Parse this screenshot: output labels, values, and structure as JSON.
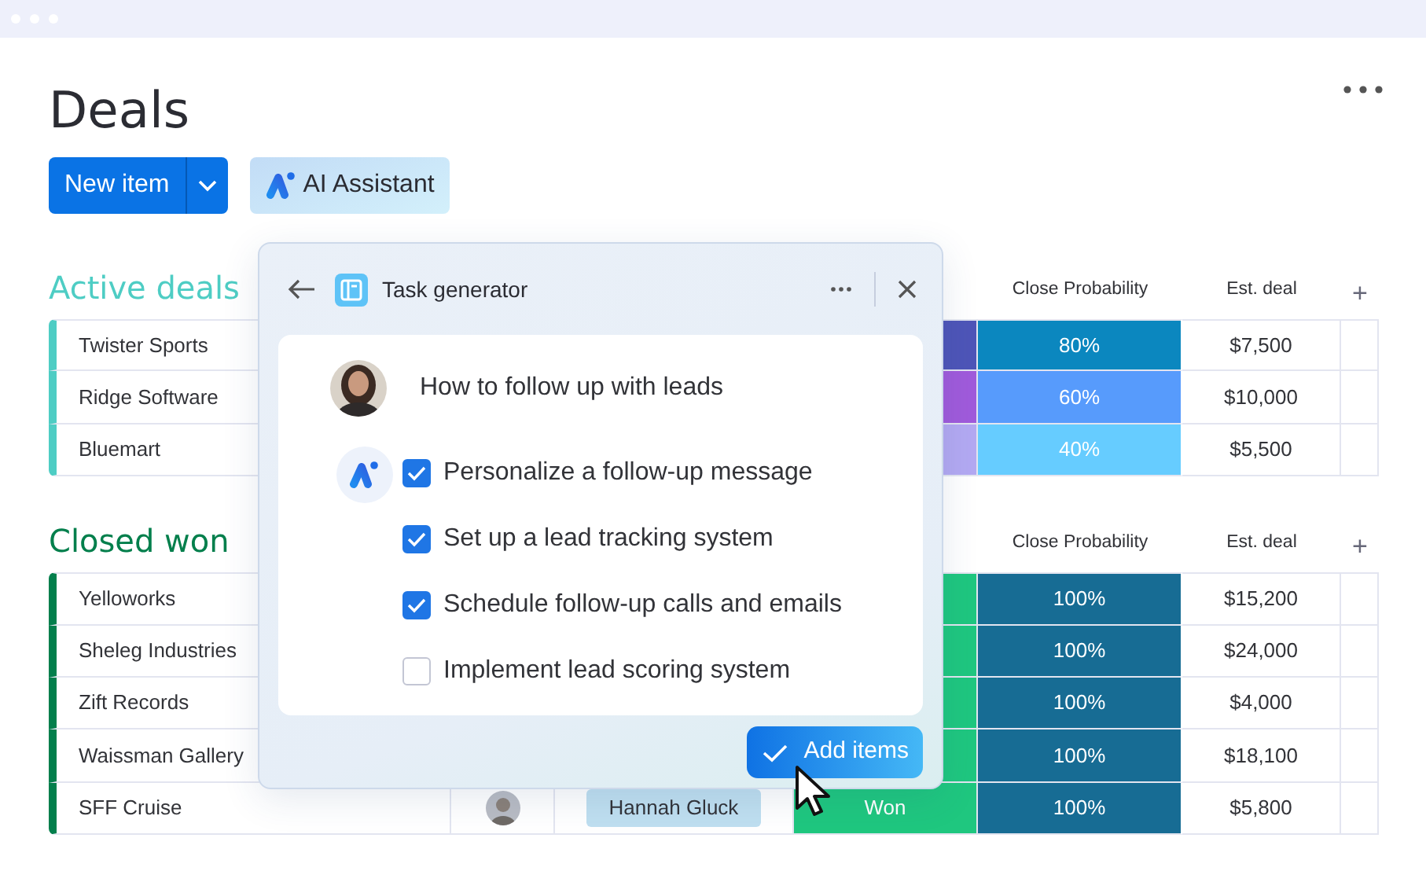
{
  "window": {
    "title": "Deals"
  },
  "toolbar": {
    "new_item": "New item",
    "ai_assistant": "AI Assistant"
  },
  "groups": [
    {
      "title": "Active deals",
      "color": "#4ecdc4",
      "columns": [
        "Close Probability",
        "Est. deal",
        "+"
      ],
      "rows": [
        {
          "name": "Twister Sports",
          "status": {
            "color": "#4e55b8"
          },
          "probability": {
            "text": "80%",
            "color": "#0b87bf"
          },
          "estimate": "$7,500"
        },
        {
          "name": "Ridge Software",
          "status": {
            "color": "#a05bdb"
          },
          "probability": {
            "text": "60%",
            "color": "#579bfc"
          },
          "estimate": "$10,000"
        },
        {
          "name": "Bluemart",
          "status": {
            "color": "#b3a9f2"
          },
          "probability": {
            "text": "40%",
            "color": "#66ccff"
          },
          "estimate": "$5,500"
        }
      ]
    },
    {
      "title": "Closed won",
      "color": "#037f4c",
      "columns": [
        "Close Probability",
        "Est. deal",
        "+"
      ],
      "rows": [
        {
          "name": "Yelloworks",
          "status": {
            "color": "#1fc77f"
          },
          "probability": {
            "text": "100%",
            "color": "#176c94"
          },
          "estimate": "$15,200"
        },
        {
          "name": "Sheleg Industries",
          "status": {
            "color": "#1fc77f"
          },
          "probability": {
            "text": "100%",
            "color": "#176c94"
          },
          "estimate": "$24,000"
        },
        {
          "name": "Zift Records",
          "status": {
            "color": "#1fc77f"
          },
          "probability": {
            "text": "100%",
            "color": "#176c94"
          },
          "estimate": "$4,000"
        },
        {
          "name": "Waissman Gallery",
          "status": {
            "color": "#1fc77f"
          },
          "probability": {
            "text": "100%",
            "color": "#176c94"
          },
          "estimate": "$18,100"
        },
        {
          "name": "SFF Cruise",
          "owner": {
            "name": "Hannah Gluck"
          },
          "status": {
            "color": "#1fc77f",
            "text": "Won"
          },
          "probability": {
            "text": "100%",
            "color": "#176c94"
          },
          "estimate": "$5,800"
        }
      ]
    }
  ],
  "task_panel": {
    "title": "Task generator",
    "prompt": "How to follow up with leads",
    "tasks": [
      {
        "label": "Personalize a follow-up message",
        "checked": true
      },
      {
        "label": "Set up a lead tracking system",
        "checked": true
      },
      {
        "label": "Schedule follow-up calls and emails",
        "checked": true
      },
      {
        "label": "Implement lead scoring system",
        "checked": false
      }
    ],
    "button": "Add items"
  }
}
